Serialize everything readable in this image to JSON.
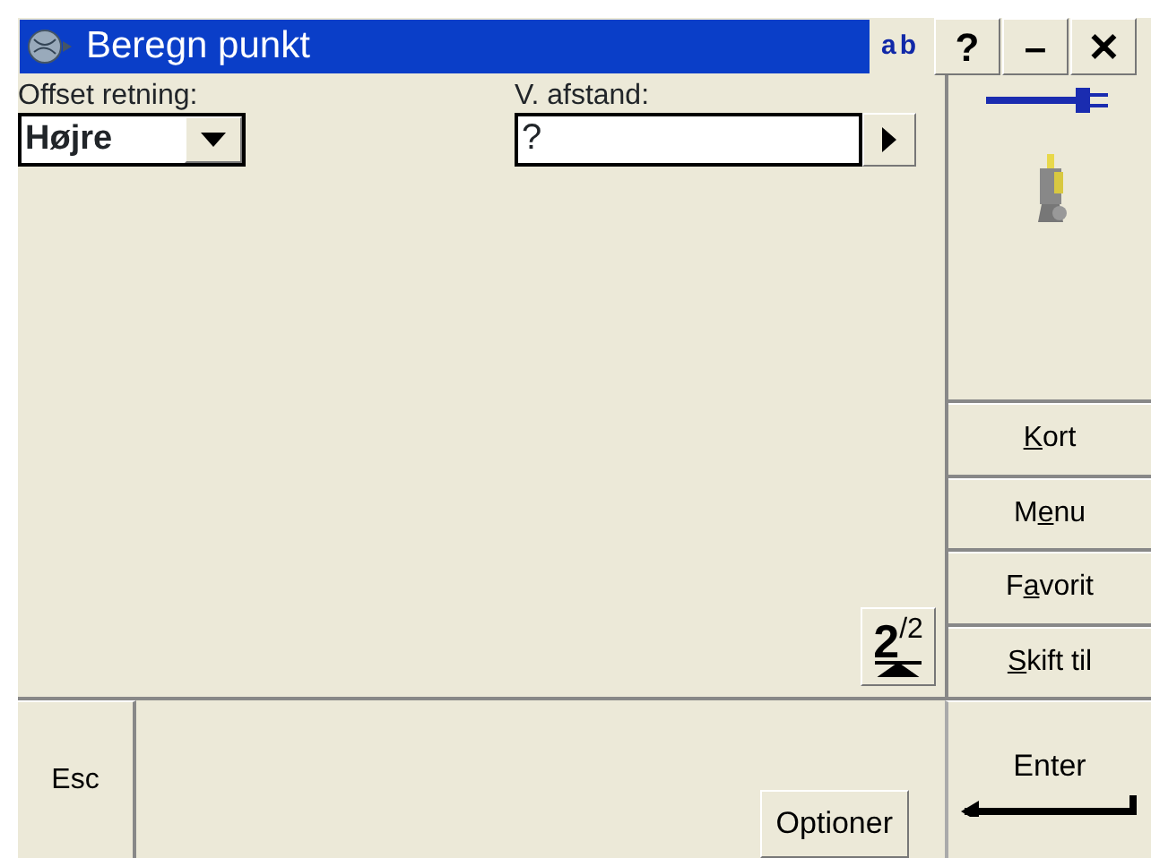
{
  "window": {
    "title": "Beregn punkt",
    "input_mode": "ab",
    "controls": [
      "?",
      "–",
      "✕"
    ]
  },
  "fields": [
    {
      "kind": "dropdown",
      "label": "Offset retning:",
      "value": "Højre"
    },
    {
      "kind": "entry",
      "label": "V. afstand:",
      "value": "?"
    }
  ],
  "page_indicator": "2$^{/2}$",
  "side_buttons": [
    {
      "key": "K",
      "after": "ort"
    },
    {
      "before": "M",
      "key": "e",
      "after": "nu"
    },
    {
      "before": "F",
      "key": "a",
      "after": "vorit"
    },
    {
      "key": "S",
      "after": "kift til"
    }
  ],
  "bottom": {
    "esc": "Esc",
    "options": "Optioner",
    "enter": "Enter"
  }
}
